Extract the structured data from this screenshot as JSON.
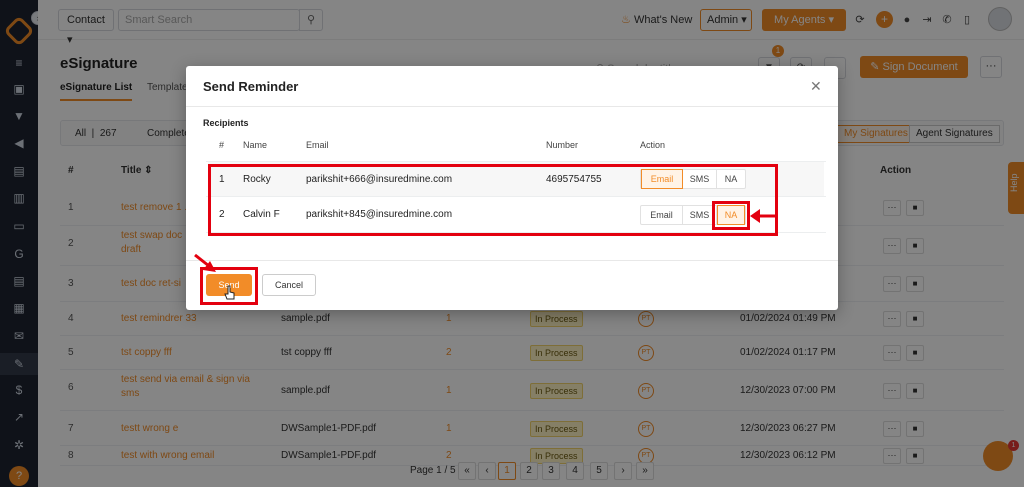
{
  "topbar": {
    "contact_select": "Contact",
    "search_placeholder": "Smart Search",
    "whats_new": "What's New",
    "admin_select": "Admin",
    "agents_button": "My Agents"
  },
  "page": {
    "title": "eSignature",
    "tabs": [
      "eSignature List",
      "Template"
    ],
    "search_placeholder": "Search by title",
    "filter_badge": "1",
    "sign_document": "Sign Document"
  },
  "filters": {
    "all_label": "All",
    "all_count": "267",
    "completed_label": "Complete",
    "my_signatures": "My Signatures",
    "agent_signatures": "Agent Signatures"
  },
  "table": {
    "headers": [
      "#",
      "Title",
      "Action"
    ],
    "rows": [
      {
        "num": "1",
        "title": "test remove 1 ..."
      },
      {
        "num": "2",
        "title": "test swap doc",
        "title2": "draft"
      },
      {
        "num": "3",
        "title": "test doc ret-si"
      },
      {
        "num": "4",
        "title": "test remindrer 33",
        "file": "sample.pdf",
        "count": "1",
        "status": "In Process",
        "initials": "PT",
        "date": "01/02/2024 01:49 PM"
      },
      {
        "num": "5",
        "title": "tst coppy fff",
        "file": "tst coppy fff",
        "count": "2",
        "status": "In Process",
        "initials": "PT",
        "date": "01/02/2024 01:17 PM"
      },
      {
        "num": "6",
        "title": "test send via email & sign via",
        "title2": "sms",
        "file": "sample.pdf",
        "count": "1",
        "status": "In Process",
        "initials": "PT",
        "date": "12/30/2023 07:00 PM"
      },
      {
        "num": "7",
        "title": "testt wrong e",
        "file": "DWSample1-PDF.pdf",
        "count": "1",
        "status": "In Process",
        "initials": "PT",
        "date": "12/30/2023 06:27 PM"
      },
      {
        "num": "8",
        "title": "test with wrong email",
        "file": "DWSample1-PDF.pdf",
        "count": "2",
        "status": "In Process",
        "initials": "PT",
        "date": "12/30/2023 06:12 PM"
      }
    ]
  },
  "pagination": {
    "label": "Page 1 / 5",
    "pages": [
      "1",
      "2",
      "3",
      "4",
      "5"
    ],
    "first": "«",
    "prev": "‹",
    "next": "›",
    "last": "»"
  },
  "help_tab": "Help",
  "chat_badge": "1",
  "modal": {
    "title": "Send Reminder",
    "recipients_label": "Recipients",
    "columns": [
      "#",
      "Name",
      "Email",
      "Number",
      "Action"
    ],
    "recipients": [
      {
        "num": "1",
        "name": "Rocky",
        "email": "parikshit+666@insuredmine.com",
        "number": "4695754755",
        "email_btn": "Email",
        "sms_btn": "SMS",
        "na_btn": "NA"
      },
      {
        "num": "2",
        "name": "Calvin F",
        "email": "parikshit+845@insuredmine.com",
        "number": "",
        "email_btn": "Email",
        "sms_btn": "SMS",
        "na_btn": "NA"
      }
    ],
    "send": "Send",
    "cancel": "Cancel"
  },
  "colors": {
    "accent": "#f28c28",
    "annotation": "#e3000f",
    "sidebar": "#1d2430"
  }
}
